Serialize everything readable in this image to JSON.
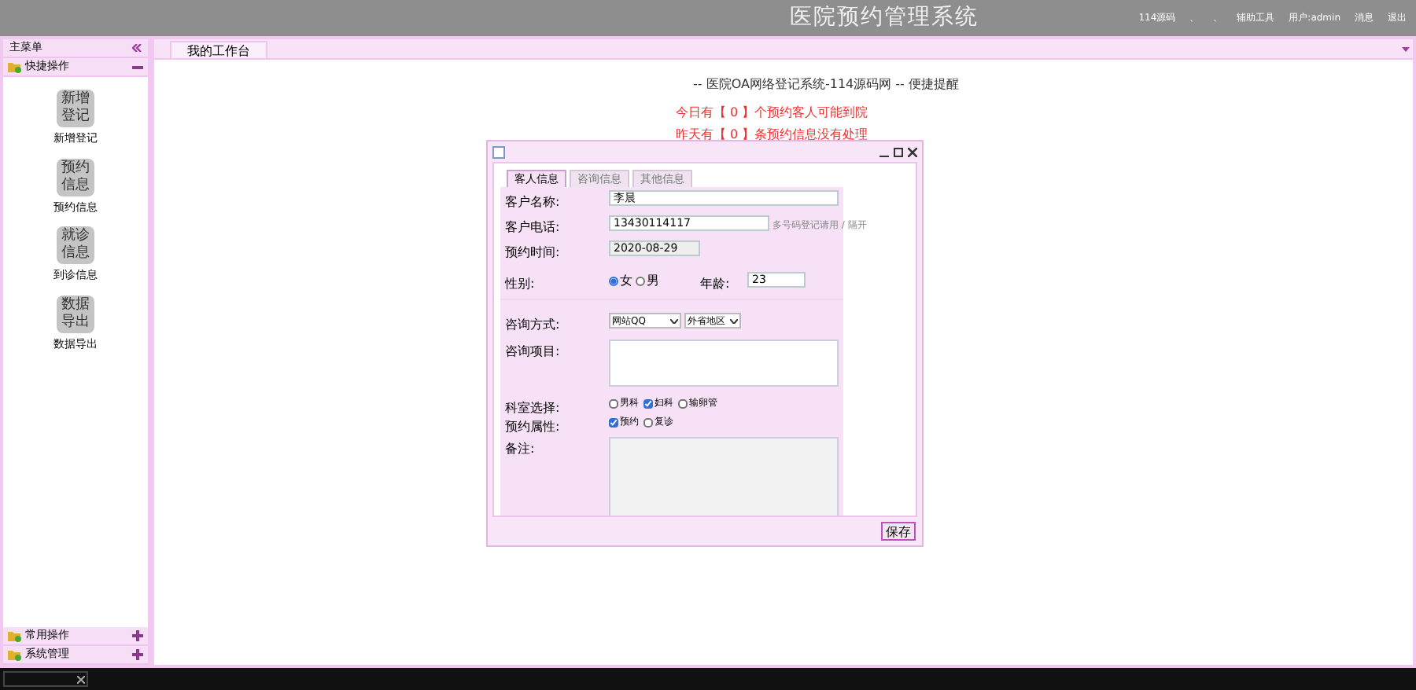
{
  "header": {
    "title": "医院预约管理系统",
    "links": [
      "114源码",
      "、",
      "、",
      "辅助工具",
      "用户:admin",
      "消息",
      "退出"
    ]
  },
  "sidebar": {
    "title": "主菜单",
    "sections": [
      {
        "label": "快捷操作",
        "expanded": true,
        "items": [
          {
            "icon_text": "新增登记",
            "label": "新增登记"
          },
          {
            "icon_text": "预约信息",
            "label": "预约信息"
          },
          {
            "icon_text": "就诊信息",
            "label": "到诊信息"
          },
          {
            "icon_text": "数据导出",
            "label": "数据导出"
          }
        ]
      },
      {
        "label": "常用操作",
        "expanded": false
      },
      {
        "label": "系统管理",
        "expanded": false
      }
    ]
  },
  "tabs": [
    {
      "label": "我的工作台",
      "selected": true
    }
  ],
  "workspace": {
    "heading": "-- 医院OA网络登记系统-114源码网 -- 便捷提醒",
    "alerts": [
      "今日有【 0 】个预约客人可能到院",
      "昨天有【 0 】条预约信息没有处理"
    ]
  },
  "dialog": {
    "tabs": [
      {
        "label": "客人信息",
        "selected": true
      },
      {
        "label": "咨询信息",
        "selected": false
      },
      {
        "label": "其他信息",
        "selected": false
      }
    ],
    "fields": [
      {
        "kind": "text",
        "label": "客户名称:",
        "value": "李晨"
      },
      {
        "kind": "text",
        "label": "客户电话:",
        "value": "13430114117",
        "hint": "多号码登记请用 / 隔开"
      },
      {
        "kind": "date",
        "label": "预约时间:",
        "value": "2020-08-29",
        "disabled": true
      },
      {
        "kind": "gender",
        "label": "性别:",
        "options": [
          {
            "label": "女",
            "selected": true
          },
          {
            "label": "男",
            "selected": false
          }
        ],
        "age_label": "年龄:",
        "age": "23"
      },
      {
        "kind": "selects",
        "label": "咨询方式:",
        "values": [
          "网站QQ",
          "外省地区"
        ]
      },
      {
        "kind": "textarea",
        "label": "咨询项目:"
      },
      {
        "kind": "checks",
        "label": "科室选择:",
        "options": [
          {
            "label": "男科",
            "checked": false
          },
          {
            "label": "妇科",
            "checked": true
          },
          {
            "label": "输卵管",
            "checked": false
          }
        ]
      },
      {
        "kind": "checks",
        "label": "预约属性:",
        "options": [
          {
            "label": "预约",
            "checked": true
          },
          {
            "label": "复诊",
            "checked": false
          }
        ]
      },
      {
        "kind": "memo",
        "label": "备注:"
      }
    ],
    "save": "保存"
  }
}
